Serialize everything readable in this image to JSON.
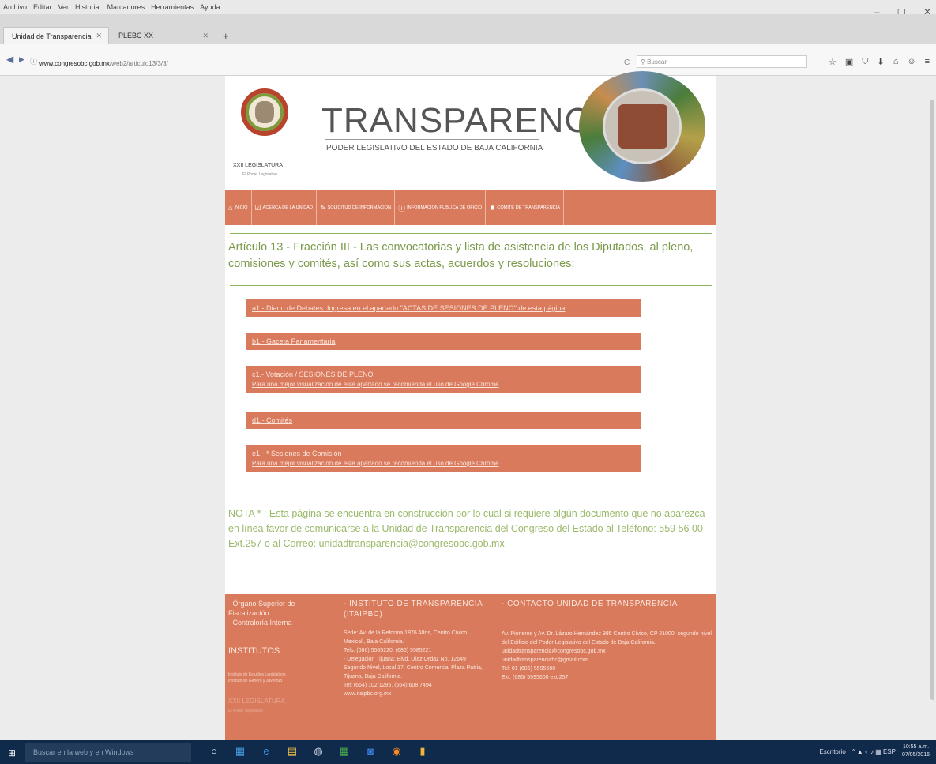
{
  "browser": {
    "menu": [
      "Archivo",
      "Editar",
      "Ver",
      "Historial",
      "Marcadores",
      "Herramientas",
      "Ayuda"
    ],
    "window_controls": [
      "–",
      "▢",
      "✕"
    ],
    "tabs": [
      {
        "label": "Unidad de Transparencia",
        "close": "✕"
      },
      {
        "label": "PLEBC XX",
        "close": "✕"
      }
    ],
    "new_tab": "+",
    "back": "◀",
    "forward": "▶",
    "info": "ⓘ",
    "url_domain": "www.congresobc.gob.mx",
    "url_path": "/web2/articulo13/3/3/",
    "reload": "C",
    "search_placeholder": "Buscar",
    "toolbar_icons": [
      "☆",
      "▣",
      "⛉",
      "⬇",
      "⌂",
      "☺",
      "≡"
    ]
  },
  "header": {
    "brand": "TRANSPARENCIA",
    "subtitle": "PODER LEGISLATIVO DEL ESTADO DE BAJA CALIFORNIA",
    "legislature": "XXII LEGISLATURA",
    "legislature_sub": "El Poder Legislativo"
  },
  "nav": [
    {
      "icon": "⌂",
      "label": "INICIO"
    },
    {
      "icon": "☑",
      "label": "ACERCA DE LA UNIDAD"
    },
    {
      "icon": "✎",
      "label": "SOLICITUD DE INFORMACIÓN"
    },
    {
      "icon": "ⓘ",
      "label": "INFORMACIÓN PÚBLICA DE OFICIO"
    },
    {
      "icon": "♜",
      "label": "COMITÉ DE TRANSPARENCIA"
    }
  ],
  "article": {
    "title": "Artículo 13 - Fracción III - Las convocatorias y lista de asistencia de los Diputados, al pleno, comisiones y comités, así como sus actas, acuerdos y resoluciones;"
  },
  "items": [
    {
      "text": "a1.- Diario de Debates: Ingresa en el apartado \"ACTAS DE SESIONES DE PLENO\" de esta página",
      "sub": ""
    },
    {
      "text": "b1.- Gaceta Parlamentaria",
      "sub": ""
    },
    {
      "text": "c1.- Votación / SESIONES DE PLENO",
      "sub": "Para una mejor visualización de este apartado se recomienda el uso de Google Chrome"
    },
    {
      "text": "d1.- Comités",
      "sub": ""
    },
    {
      "text": "e1.- * Sesiones de Comisión",
      "sub": "Para una mejor visualización de este apartado se recomienda el uso de Google Chrome"
    }
  ],
  "nota": "NOTA * : Esta página se encuentra en construcción por lo cual si requiere algún documento que no aparezca en línea favor de comunicarse a la Unidad de Transparencia del Congreso del Estado al Teléfono: 559 56 00 Ext.257 o al Correo: unidadtransparencia@congresobc.gob.mx",
  "footer": {
    "col1": {
      "lines": [
        "- Órgano Superior de Fiscalización",
        "- Contraloría Interna"
      ],
      "institutos_head": "INSTITUTOS",
      "small": [
        "Instituto de Estudios Legislativos",
        "Instituto de Género y Juventud"
      ],
      "faded": [
        "XXII LEGISLATURA",
        "El Poder Legislativo"
      ]
    },
    "col2": {
      "head": "- INSTITUTO DE TRANSPARENCIA (ITAIPBC)",
      "lines": [
        "Sede: Av. de la Reforma 1876 Altos, Centro Cívico, Mexicali, Baja California.",
        "Tels: (686) 5585220, (686) 5585221",
        "- Delegación Tijuana: Blvd. Díaz Ordaz No. 12649 Segundo Nivel, Local 17, Centro Comercial Plaza Patria, Tijuana, Baja California.",
        "Tel: (664) 102 1295, (664) 608 7494",
        "www.itaipbc.org.mx"
      ]
    },
    "col3": {
      "head": "- CONTACTO UNIDAD DE TRANSPARENCIA",
      "lines": [
        "Av. Pioneros y Av. Dr. Lázaro Hernández 995 Centro Cívico, CP 21000, segundo nivel del Edificio del Poder Legislativo del Estado de Baja California.",
        "unidadtransparencia@congresobc.gob.mx",
        "unidadtransparenciabc@gmail.com",
        "Tel: 01 (686) 5595600",
        "Ext. (686) 5595600 ext.257"
      ]
    }
  },
  "taskbar": {
    "start": "⊞",
    "search": "Buscar en la web y en Windows",
    "apps": [
      "○",
      "▦",
      "e",
      "▤",
      "◍",
      "▦",
      "◙",
      "◉",
      "▮"
    ],
    "tray_lang": "Escritorio",
    "tray_icons": "^ ▲ ◐ ♪ ▦ ESP",
    "time": "10:55 a.m.",
    "date": "07/05/2016"
  },
  "colors": {
    "accent": "#d97a5c",
    "green_text": "#7a9a4a",
    "rule": "#8ab35c",
    "taskbar": "#0f2a4a"
  }
}
